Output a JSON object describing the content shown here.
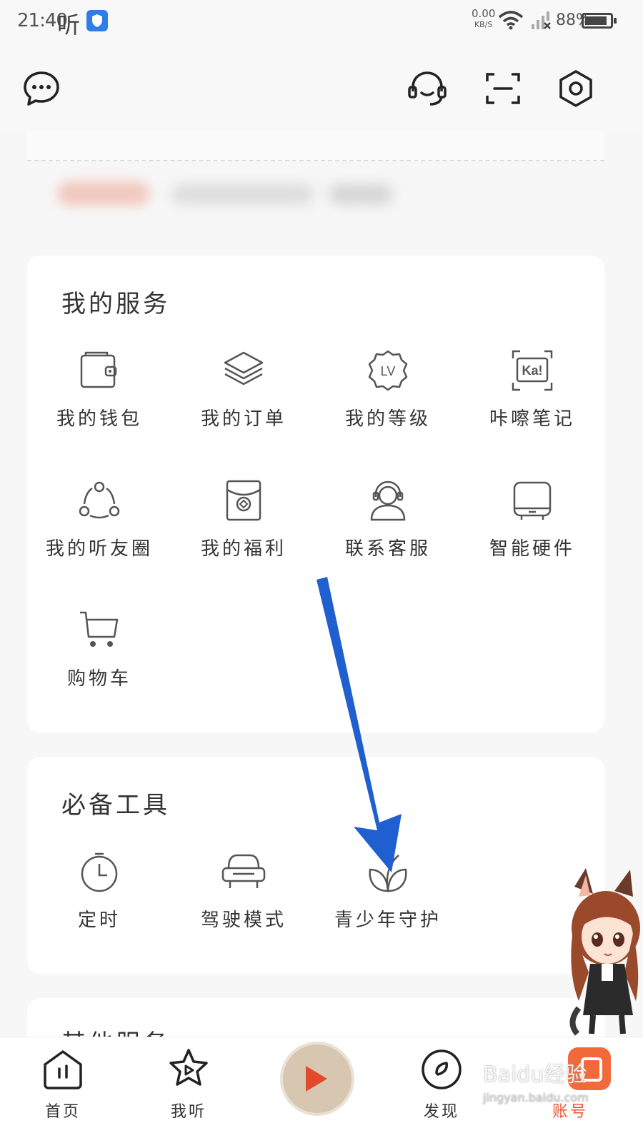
{
  "status_bar": {
    "time": "21:40",
    "app_badge": "听",
    "net_speed": "0.00",
    "net_unit": "KB/S",
    "battery": "88%",
    "battery_level": 0.88
  },
  "top_bar": {
    "icons": [
      "message-icon",
      "customer-service-icon",
      "scan-icon",
      "settings-icon"
    ]
  },
  "my_services": {
    "title": "我的服务",
    "items": [
      {
        "label": "我的钱包",
        "icon": "wallet-icon"
      },
      {
        "label": "我的订单",
        "icon": "orders-icon"
      },
      {
        "label": "我的等级",
        "icon": "level-icon"
      },
      {
        "label": "咔嚓笔记",
        "icon": "ka-notes-icon"
      },
      {
        "label": "我的听友圈",
        "icon": "friends-circle-icon"
      },
      {
        "label": "我的福利",
        "icon": "welfare-icon"
      },
      {
        "label": "联系客服",
        "icon": "customer-service-icon"
      },
      {
        "label": "智能硬件",
        "icon": "smart-hardware-icon"
      },
      {
        "label": "购物车",
        "icon": "cart-icon"
      }
    ]
  },
  "tools": {
    "title": "必备工具",
    "items": [
      {
        "label": "定时",
        "icon": "timer-icon"
      },
      {
        "label": "驾驶模式",
        "icon": "car-icon"
      },
      {
        "label": "青少年守护",
        "icon": "leaf-icon"
      }
    ]
  },
  "more_section": {
    "title": "其他服务"
  },
  "tab_bar": {
    "tabs": [
      {
        "label": "首页",
        "icon": "home-icon"
      },
      {
        "label": "我听",
        "icon": "my-listen-icon"
      },
      {
        "label": "",
        "icon": "now-playing-disc"
      },
      {
        "label": "发现",
        "icon": "discover-icon"
      },
      {
        "label": "账号",
        "icon": "account-icon"
      }
    ],
    "active_color": "#e8542e"
  },
  "colors": {
    "accent": "#e8542e",
    "arrow": "#1f5fcf",
    "background": "#f7f7f7",
    "card": "#ffffff"
  },
  "watermark": {
    "text": "Baidu经验",
    "sub": "jingyan.baidu.com"
  }
}
